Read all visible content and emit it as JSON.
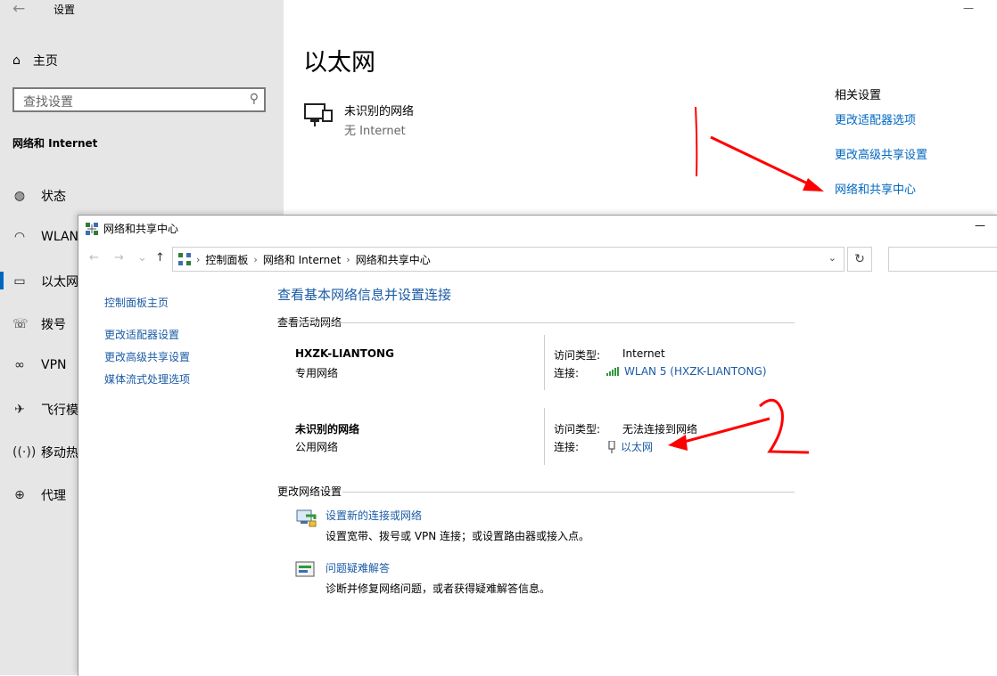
{
  "settings": {
    "window_title": "设置",
    "home_label": "主页",
    "search_placeholder": "查找设置",
    "section_heading": "网络和 Internet",
    "nav": [
      "状态",
      "WLAN",
      "以太网",
      "拨号",
      "VPN",
      "飞行模",
      "移动热",
      "代理"
    ],
    "page_title": "以太网",
    "network_name": "未识别的网络",
    "network_status": "无 Internet",
    "related_heading": "相关设置",
    "related_links": [
      "更改适配器选项",
      "更改高级共享设置",
      "网络和共享中心"
    ]
  },
  "control_panel": {
    "window_title": "网络和共享中心",
    "breadcrumb": [
      "控制面板",
      "网络和 Internet",
      "网络和共享中心"
    ],
    "left_links": [
      "控制面板主页",
      "更改适配器设置",
      "更改高级共享设置",
      "媒体流式处理选项"
    ],
    "heading": "查看基本网络信息并设置连接",
    "active_networks_label": "查看活动网络",
    "networks": [
      {
        "name": "HXZK-LIANTONG",
        "type": "专用网络",
        "access_label": "访问类型:",
        "access_value": "Internet",
        "conn_label": "连接:",
        "conn_value": "WLAN 5 (HXZK-LIANTONG)"
      },
      {
        "name": "未识别的网络",
        "type": "公用网络",
        "access_label": "访问类型:",
        "access_value": "无法连接到网络",
        "conn_label": "连接:",
        "conn_value": "以太网"
      }
    ],
    "change_settings_label": "更改网络设置",
    "tasks": [
      {
        "link": "设置新的连接或网络",
        "desc": "设置宽带、拨号或 VPN 连接；或设置路由器或接入点。"
      },
      {
        "link": "问题疑难解答",
        "desc": "诊断并修复网络问题，或者获得疑难解答信息。"
      }
    ]
  },
  "colors": {
    "link": "#1a5ba6",
    "settings_link": "#0067c0",
    "annotation": "#ff0000"
  }
}
